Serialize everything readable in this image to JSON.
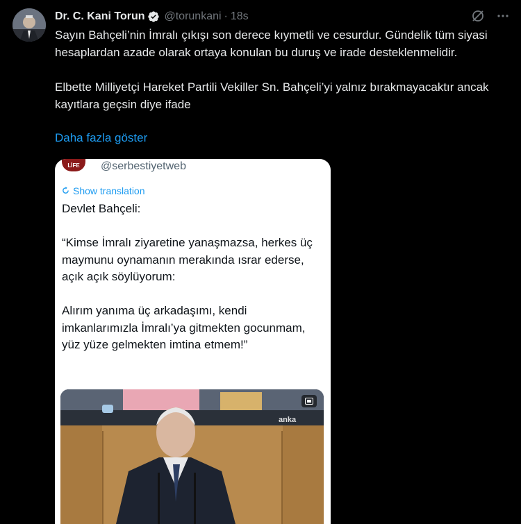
{
  "author": {
    "name": "Dr. C. Kani Torun",
    "handle": "@torunkani",
    "separator": "·",
    "time": "18s"
  },
  "tweet": {
    "text": "Sayın Bahçeli’nin İmralı çıkışı son derece kıymetli ve cesurdur. Gündelik tüm siyasi hesaplardan azade olarak ortaya konulan bu duruş ve irade desteklenmelidir.\n\nElbette Milliyetçi Hareket Partili Vekiller Sn. Bahçeli’yi yalnız bırakmayacaktır ancak kayıtlara geçsin diye ifade",
    "show_more": "Daha fazla göster"
  },
  "media": {
    "logo_text": "LİFE",
    "handle": "@serbestiyetweb",
    "translate": "Show translation",
    "body": "Devlet Bahçeli:\n\n“Kimse İmralı ziyaretine yanaşmazsa, herkes üç maymunu oynamanın merakında ısrar ederse, açık açık söylüyorum:\n\nAlırım yanıma üç arkadaşımı, kendi imkanlarımızla İmralı’ya gitmekten gocunmam, yüz yüze gelmekten imtina etmem!”",
    "watermark": "anka"
  },
  "colors": {
    "background": "#000000",
    "text": "#e7e9ea",
    "secondary": "#71767b",
    "accent": "#1d9bf0"
  }
}
